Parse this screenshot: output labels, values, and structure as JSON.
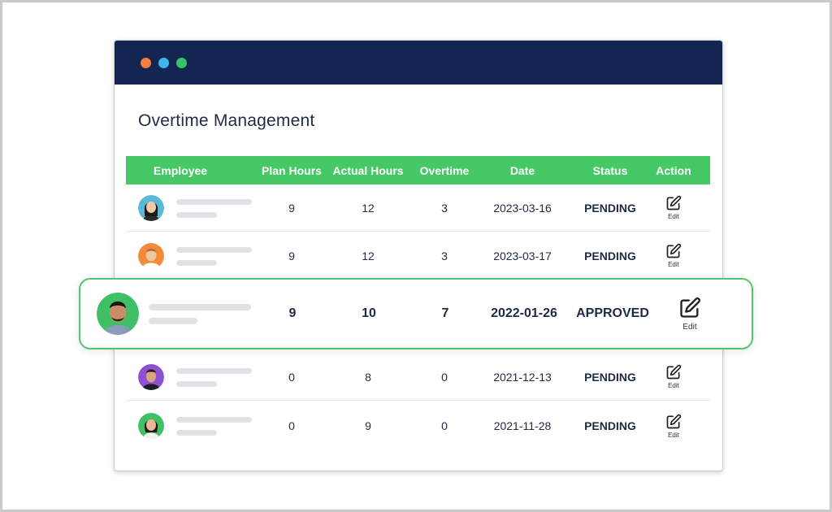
{
  "page": {
    "title": "Overtime Management"
  },
  "table": {
    "headers": {
      "employee": "Employee",
      "plan": "Plan Hours",
      "actual": "Actual Hours",
      "overtime": "Overtime",
      "date": "Date",
      "status": "Status",
      "action": "Action"
    },
    "rows": [
      {
        "plan": "9",
        "actual": "12",
        "overtime": "3",
        "date": "2023-03-16",
        "status": "PENDING",
        "edit": "Edit"
      },
      {
        "plan": "9",
        "actual": "12",
        "overtime": "3",
        "date": "2023-03-17",
        "status": "PENDING",
        "edit": "Edit"
      },
      {
        "plan": "9",
        "actual": "10",
        "overtime": "7",
        "date": "2022-01-26",
        "status": "APPROVED",
        "edit": "Edit"
      },
      {
        "plan": "0",
        "actual": "8",
        "overtime": "0",
        "date": "2021-12-13",
        "status": "PENDING",
        "edit": "Edit"
      },
      {
        "plan": "0",
        "actual": "9",
        "overtime": "0",
        "date": "2021-11-28",
        "status": "PENDING",
        "edit": "Edit"
      }
    ]
  },
  "colors": {
    "titlebar": "#142552",
    "header": "#47c867",
    "dot_orange": "#f47c3c",
    "dot_blue": "#3cb6e8",
    "dot_green": "#36c46a"
  },
  "icons": {
    "edit": "edit-icon",
    "avatar": "user-avatar"
  }
}
